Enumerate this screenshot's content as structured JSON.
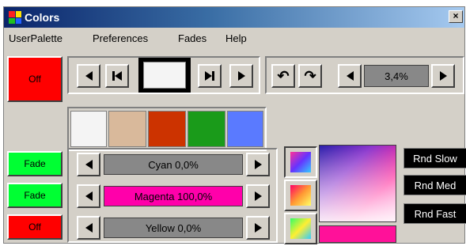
{
  "window": {
    "title": "Colors",
    "close_glyph": "×"
  },
  "menu": [
    {
      "label": "UserPalette"
    },
    {
      "label": "Preferences"
    },
    {
      "label": "Fades"
    },
    {
      "label": "Help"
    }
  ],
  "top_row": {
    "off_button": "Off",
    "undo_icon": "↶",
    "redo_icon": "↷",
    "zoom_value": "3,4%"
  },
  "palette": {
    "swatches": [
      "#f4f4f4",
      "#d9b99b",
      "#cc3300",
      "#1a9b1a",
      "#5a7aff"
    ]
  },
  "channels": [
    {
      "button": "Fade",
      "button_color": "#00ff33",
      "label": "Cyan 0,0%",
      "track_color": "#888888",
      "value": 0.0
    },
    {
      "button": "Fade",
      "button_color": "#00ff33",
      "label": "Magenta 100,0%",
      "track_color": "#ff00aa",
      "value": 100.0
    },
    {
      "button": "Off",
      "button_color": "#ff0000",
      "label": "Yellow 0,0%",
      "track_color": "#888888",
      "value": 0.0
    }
  ],
  "colors": {
    "off_red": "#ff0000",
    "fade_green": "#00ff33",
    "current_color": "#ff1199"
  },
  "random_buttons": [
    {
      "label": "Rnd Slow"
    },
    {
      "label": "Rnd Med"
    },
    {
      "label": "Rnd Fast"
    }
  ]
}
